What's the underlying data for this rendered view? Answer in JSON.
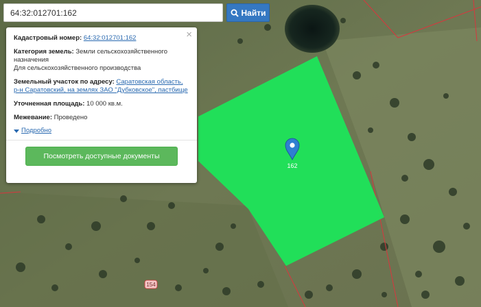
{
  "search": {
    "value": "64:32:012701:162",
    "button_label": "Найти"
  },
  "popup": {
    "cadastral_label": "Кадастровый номер:",
    "cadastral_value": "64:32:012701:162",
    "category_label": "Категория земель:",
    "category_value": "Земли сельскохозяйственного назначения",
    "usage_value": "Для сельскохозяйственного производства",
    "address_label": "Земельный участок по адресу:",
    "address_value": "Саратовская область, р-н Саратовский, на землях ЗАО \"Дубковское\", пастбище",
    "area_label": "Уточненная площадь:",
    "area_value": "10 000 кв.м.",
    "survey_label": "Межевание:",
    "survey_value": "Проведено",
    "more_label": "Подробно",
    "docs_button": "Посмотреть доступные документы",
    "close_symbol": "×"
  },
  "map": {
    "parcel_label": "162",
    "road_label": "154",
    "parcel_color": "#1ee35a",
    "boundary_color": "#d9363e",
    "marker_color": "#2f7fd1"
  }
}
